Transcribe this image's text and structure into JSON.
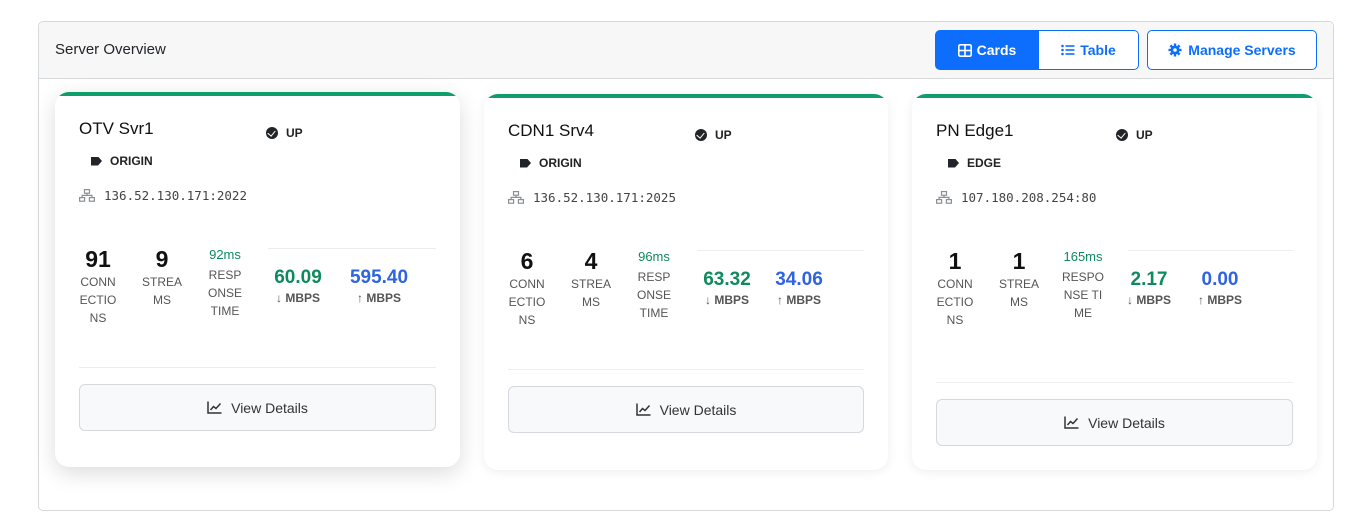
{
  "header": {
    "title": "Server Overview",
    "cards_label": "Cards",
    "table_label": "Table",
    "manage_label": "Manage Servers",
    "cards_icon": "grid-icon",
    "table_icon": "list-icon",
    "manage_icon": "gear-icon"
  },
  "colors": {
    "accent": "#0d6efd",
    "up": "#0f9d6a",
    "download": "#0f8a5f",
    "upload": "#2f63e0"
  },
  "servers": [
    {
      "name": "OTV Svr1",
      "status": "UP",
      "type": "ORIGIN",
      "address": "136.52.130.171:2022",
      "connections": "91",
      "connections_label": "CONNECTIONS",
      "streams": "9",
      "streams_label": "STREAMS",
      "response": "92ms",
      "response_label": "RESPONSE TIME",
      "down": "60.09",
      "down_label": "↓ MBPS",
      "up": "595.40",
      "up_label": "↑ MBPS",
      "details_label": "View Details"
    },
    {
      "name": "CDN1 Srv4",
      "status": "UP",
      "type": "ORIGIN",
      "address": "136.52.130.171:2025",
      "connections": "6",
      "connections_label": "CONNECTIONS",
      "streams": "4",
      "streams_label": "STREAMS",
      "response": "96ms",
      "response_label": "RESPONSE TIME",
      "down": "63.32",
      "down_label": "↓ MBPS",
      "up": "34.06",
      "up_label": "↑ MBPS",
      "details_label": "View Details"
    },
    {
      "name": "PN Edge1",
      "status": "UP",
      "type": "EDGE",
      "address": "107.180.208.254:80",
      "connections": "1",
      "connections_label": "CONNECTIONS",
      "streams": "1",
      "streams_label": "STREAMS",
      "response": "165ms",
      "response_label": "RESPONSE TIME",
      "down": "2.17",
      "down_label": "↓ MBPS",
      "up": "0.00",
      "up_label": "↑ MBPS",
      "details_label": "View Details"
    }
  ]
}
